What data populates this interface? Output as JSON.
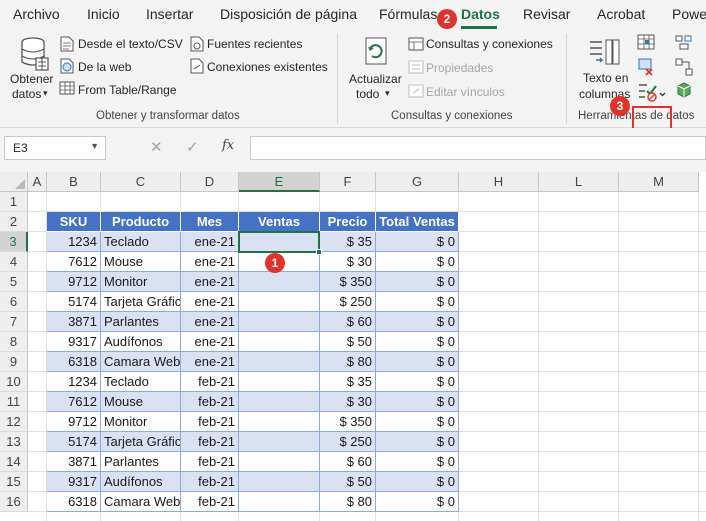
{
  "tabs": [
    "Archivo",
    "Inicio",
    "Insertar",
    "Disposición de página",
    "Fórmulas",
    "Datos",
    "Revisar",
    "Acrobat",
    "Powe"
  ],
  "active_tab": "Datos",
  "ribbon": {
    "get_data": {
      "line1": "Obtener",
      "line2": "datos"
    },
    "from_text_csv": "Desde el texto/CSV",
    "from_web": "De la web",
    "from_table": "From Table/Range",
    "recent_sources": "Fuentes recientes",
    "existing_connections": "Conexiones existentes",
    "group_get_transform": "Obtener y transformar datos",
    "refresh_all": {
      "line1": "Actualizar",
      "line2": "todo"
    },
    "queries_connections": "Consultas y conexiones",
    "properties": "Propiedades",
    "edit_links": "Editar vínculos",
    "group_queries": "Consultas y conexiones",
    "text_to_columns": {
      "line1": "Texto en",
      "line2": "columnas"
    },
    "group_data_tools": "Herramientas de datos"
  },
  "formula_bar": {
    "name_box": "E3",
    "cancel": "✕",
    "enter": "✓",
    "fx": "fx",
    "formula": ""
  },
  "columns": [
    "A",
    "B",
    "C",
    "D",
    "E",
    "F",
    "G",
    "H",
    "L",
    "M"
  ],
  "rows": [
    "1",
    "2",
    "3",
    "4",
    "5",
    "6",
    "7",
    "8",
    "9",
    "10",
    "11",
    "12",
    "13",
    "14",
    "15",
    "16"
  ],
  "table": {
    "headers": [
      "SKU",
      "Producto",
      "Mes",
      "Ventas",
      "Precio",
      "Total Ventas"
    ],
    "rows": [
      [
        "1234",
        "Teclado",
        "ene-21",
        "",
        "$ 35",
        "$ 0"
      ],
      [
        "7612",
        "Mouse",
        "ene-21",
        "",
        "$ 30",
        "$ 0"
      ],
      [
        "9712",
        "Monitor",
        "ene-21",
        "",
        "$ 350",
        "$ 0"
      ],
      [
        "5174",
        "Tarjeta Gráfica",
        "ene-21",
        "",
        "$ 250",
        "$ 0"
      ],
      [
        "3871",
        "Parlantes",
        "ene-21",
        "",
        "$ 60",
        "$ 0"
      ],
      [
        "9317",
        "Audífonos",
        "ene-21",
        "",
        "$ 50",
        "$ 0"
      ],
      [
        "6318",
        "Camara Web",
        "ene-21",
        "",
        "$ 80",
        "$ 0"
      ],
      [
        "1234",
        "Teclado",
        "feb-21",
        "",
        "$ 35",
        "$ 0"
      ],
      [
        "7612",
        "Mouse",
        "feb-21",
        "",
        "$ 30",
        "$ 0"
      ],
      [
        "9712",
        "Monitor",
        "feb-21",
        "",
        "$ 350",
        "$ 0"
      ],
      [
        "5174",
        "Tarjeta Gráfica",
        "feb-21",
        "",
        "$ 250",
        "$ 0"
      ],
      [
        "3871",
        "Parlantes",
        "feb-21",
        "",
        "$ 60",
        "$ 0"
      ],
      [
        "9317",
        "Audífonos",
        "feb-21",
        "",
        "$ 50",
        "$ 0"
      ],
      [
        "6318",
        "Camara Web",
        "feb-21",
        "",
        "$ 80",
        "$ 0"
      ]
    ]
  },
  "callouts": [
    "1",
    "2",
    "3"
  ],
  "colors": {
    "accent": "#217346",
    "table_header": "#4472c4",
    "band": "#d9e1f2",
    "callout": "#e0332b"
  }
}
